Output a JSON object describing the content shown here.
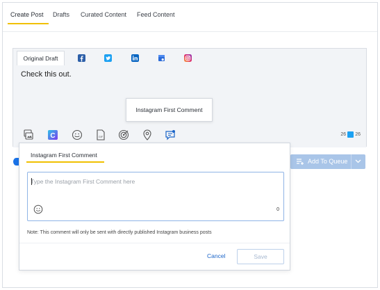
{
  "tabs": [
    {
      "label": "Create Post",
      "active": true
    },
    {
      "label": "Drafts",
      "active": false
    },
    {
      "label": "Curated Content",
      "active": false
    },
    {
      "label": "Feed Content",
      "active": false
    }
  ],
  "composer": {
    "original_tab_label": "Original Draft",
    "network_icons": [
      "facebook-icon",
      "twitter-icon",
      "linkedin-icon",
      "google-my-business-icon",
      "instagram-icon"
    ],
    "text": "Check this out.",
    "toolbar_icons": [
      "media-library-icon",
      "canva-icon",
      "emoji-icon",
      "gif-icon",
      "target-icon",
      "location-icon",
      "instagram-first-comment-icon"
    ],
    "counter_left": "26",
    "counter_right": "26"
  },
  "tooltip": {
    "text": "Instagram First Comment"
  },
  "queue_button": {
    "label": "Add To Queue"
  },
  "popup": {
    "title": "Instagram First Comment",
    "placeholder": "Type the Instagram First Comment here",
    "char_count": "0",
    "note": "Note: This comment will only be sent with directly published Instagram business posts",
    "cancel_label": "Cancel",
    "save_label": "Save"
  },
  "colors": {
    "accent_underline": "#f0c000",
    "primary_blue": "#1a64c8",
    "queue_button": "#a9c5e8"
  }
}
